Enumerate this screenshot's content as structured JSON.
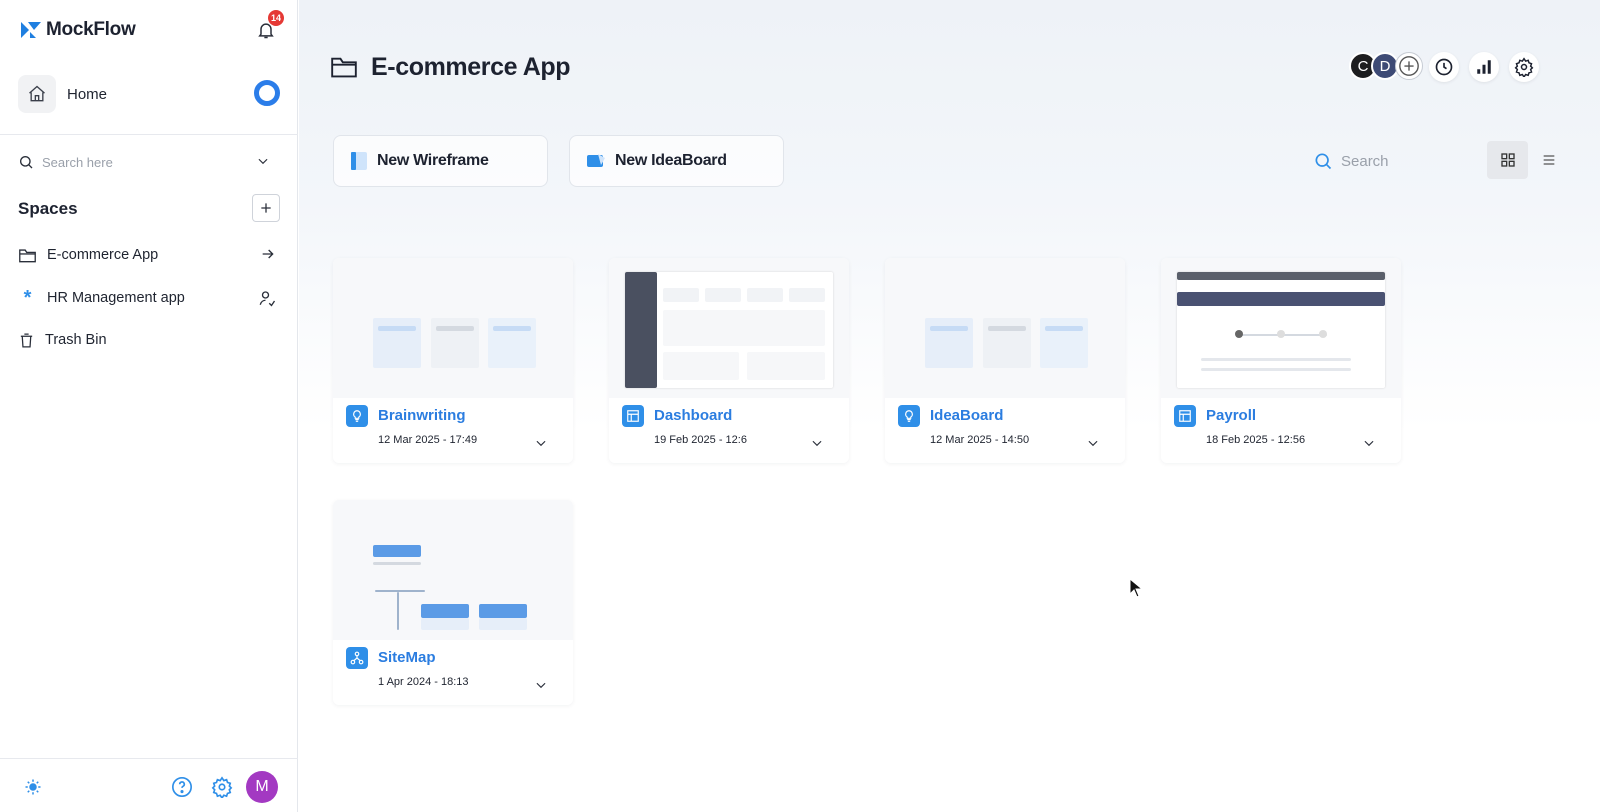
{
  "sidebar": {
    "brand": "MockFlow",
    "notifications_count": "14",
    "home_label": "Home",
    "search_placeholder": "Search here",
    "spaces_title": "Spaces",
    "spaces": [
      {
        "label": "E-commerce App",
        "icon": "folder-icon",
        "trail_icon": "arrow-right-icon"
      },
      {
        "label": "HR Management app",
        "icon": "asterisk-icon",
        "trail_icon": "user-share-icon"
      },
      {
        "label": "Trash Bin",
        "icon": "trash-icon",
        "trail_icon": ""
      }
    ],
    "user_initial": "M"
  },
  "header": {
    "title": "E-commerce App",
    "collaborators": [
      "C",
      "D"
    ],
    "search_placeholder": "Search"
  },
  "actions": {
    "new_wireframe": "New Wireframe",
    "new_ideaboard": "New IdeaBoard"
  },
  "projects": [
    {
      "name": "Brainwriting",
      "date": "12 Mar 2025 - 17:49",
      "icon": "lightbulb-icon"
    },
    {
      "name": "Dashboard",
      "date": "19 Feb 2025 - 12:6",
      "icon": "layout-icon"
    },
    {
      "name": "IdeaBoard",
      "date": "12 Mar 2025 - 14:50",
      "icon": "lightbulb-icon"
    },
    {
      "name": "Payroll",
      "date": "18 Feb 2025 - 12:56",
      "icon": "layout-icon"
    },
    {
      "name": "SiteMap",
      "date": "1 Apr 2024 - 18:13",
      "icon": "sitemap-icon"
    }
  ],
  "colors": {
    "accent": "#2b7de0",
    "badge": "#e53935",
    "avatar": "#a339c2"
  }
}
